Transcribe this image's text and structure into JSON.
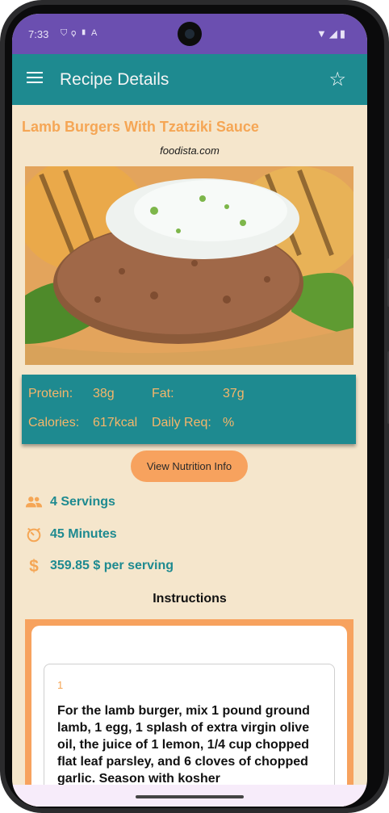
{
  "status_bar": {
    "time": "7:33",
    "left_icons": [
      "shield-icon",
      "nav-icon",
      "sim-icon",
      "letter-a-icon"
    ],
    "right_icons": [
      "wifi-icon",
      "signal-icon",
      "battery-icon"
    ]
  },
  "appbar": {
    "title": "Recipe Details",
    "menu_icon": "hamburger-icon",
    "favorite_icon": "star-outline-icon"
  },
  "recipe": {
    "title": "Lamb Burgers With Tzatziki Sauce",
    "source": "foodista.com"
  },
  "nutrition": {
    "protein_label": "Protein:",
    "protein_value": "38g",
    "fat_label": "Fat:",
    "fat_value": "37g",
    "calories_label": "Calories:",
    "calories_value": "617kcal",
    "daily_label": "Daily Req:",
    "daily_value": "%"
  },
  "buttons": {
    "view_nutrition": "View Nutrition Info"
  },
  "info": {
    "servings": "4 Servings",
    "minutes": "45 Minutes",
    "price": "359.85 $ per serving"
  },
  "instructions": {
    "heading": "Instructions",
    "steps": [
      {
        "number": "1",
        "text": "For the lamb burger, mix 1 pound ground lamb, 1 egg, 1 splash of extra virgin olive oil, the juice of 1 lemon, 1/4 cup chopped flat leaf parsley, and 6 cloves of chopped garlic. Season with kosher"
      }
    ]
  },
  "colors": {
    "status_bar": "#6b4fb0",
    "app_bar": "#1e8a90",
    "background": "#f5e6cc",
    "accent_orange": "#f7a25e",
    "title_orange": "#f5a655"
  }
}
